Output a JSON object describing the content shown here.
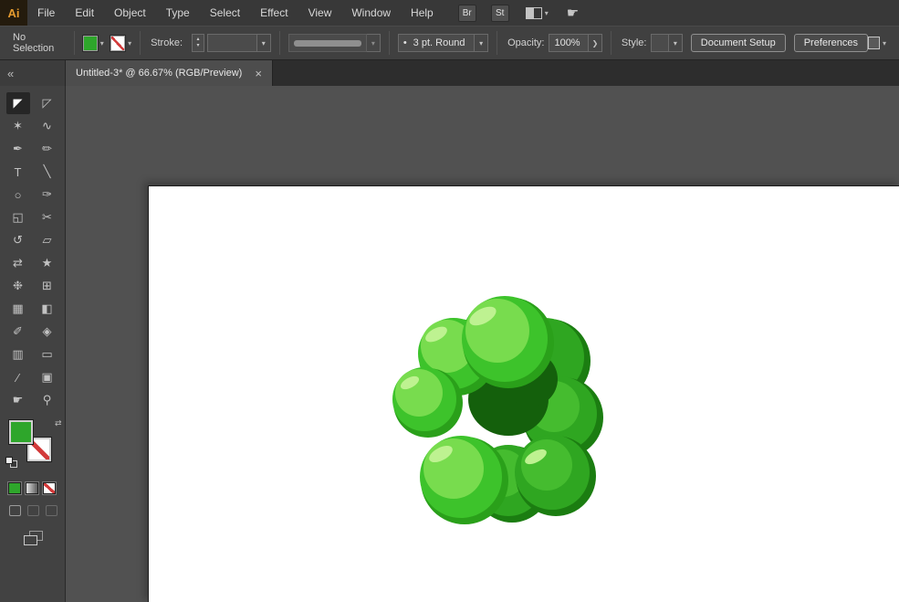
{
  "menu_bar": {
    "logo_text": "Ai",
    "items": [
      "File",
      "Edit",
      "Object",
      "Type",
      "Select",
      "Effect",
      "View",
      "Window",
      "Help"
    ],
    "bridge_button_label": "Br",
    "stock_button_label": "St"
  },
  "glyphs": {
    "caret_down": "▾",
    "caret_up": "▴",
    "caret_right": "❯",
    "swap": "⇄",
    "collapse": "«",
    "close": "×",
    "bullet": "•",
    "touch": "☛"
  },
  "control_bar": {
    "selection_status": "No Selection",
    "stroke_label": "Stroke:",
    "brush_value": "3 pt. Round",
    "opacity_label": "Opacity:",
    "opacity_value": "100%",
    "style_label": "Style:",
    "document_setup_label": "Document Setup",
    "preferences_label": "Preferences",
    "fill_color": "#2EA62B",
    "stroke_slash_color": "#D23A3A"
  },
  "tab_bar": {
    "tab_title": "Untitled-3* @ 66.67% (RGB/Preview)"
  },
  "toolbar": {
    "tools": [
      {
        "name": "selection-tool",
        "glyph": "◤"
      },
      {
        "name": "direct-selection-tool",
        "glyph": "◸"
      },
      {
        "name": "magic-wand-tool",
        "glyph": "✶"
      },
      {
        "name": "lasso-tool",
        "glyph": "∿"
      },
      {
        "name": "pen-tool",
        "glyph": "✒"
      },
      {
        "name": "pencil-tool",
        "glyph": "✏"
      },
      {
        "name": "type-tool",
        "glyph": "T"
      },
      {
        "name": "line-segment-tool",
        "glyph": "╲"
      },
      {
        "name": "ellipse-tool",
        "glyph": "○"
      },
      {
        "name": "paintbrush-tool",
        "glyph": "✑"
      },
      {
        "name": "shape-builder-tool",
        "glyph": "◱"
      },
      {
        "name": "scissors-tool",
        "glyph": "✂"
      },
      {
        "name": "rotate-tool",
        "glyph": "↺"
      },
      {
        "name": "scale-tool",
        "glyph": "▱"
      },
      {
        "name": "width-tool",
        "glyph": "⇄"
      },
      {
        "name": "free-transform-tool",
        "glyph": "★"
      },
      {
        "name": "symbol-sprayer-tool",
        "glyph": "❉"
      },
      {
        "name": "perspective-grid-tool",
        "glyph": "⊞"
      },
      {
        "name": "mesh-tool",
        "glyph": "▦"
      },
      {
        "name": "gradient-tool",
        "glyph": "◧"
      },
      {
        "name": "eyedropper-tool",
        "glyph": "✐"
      },
      {
        "name": "blend-tool",
        "glyph": "◈"
      },
      {
        "name": "column-graph-tool",
        "glyph": "▥"
      },
      {
        "name": "artboard-tool",
        "glyph": "▭"
      },
      {
        "name": "slice-tool",
        "glyph": "∕"
      },
      {
        "name": "live-paint-bucket-tool",
        "glyph": "▣"
      },
      {
        "name": "hand-tool",
        "glyph": "☛"
      },
      {
        "name": "zoom-tool",
        "glyph": "⚲"
      }
    ]
  },
  "swatch_panel": {
    "fill_color": "#2EA62B"
  },
  "artwork": {
    "label": "green broccoli illustration",
    "colors": {
      "bright": "#3DC32B",
      "light": "#78DC4E",
      "gloss": "#BEF291",
      "shadow": "#2AA01A",
      "mid": "#2FA621",
      "midlight": "#45BC2F",
      "deep": "#1B7D11",
      "hole": "#14600C"
    }
  }
}
